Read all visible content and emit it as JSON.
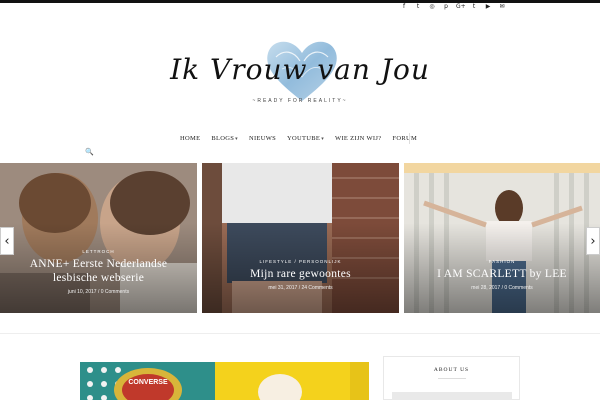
{
  "social_icons": [
    {
      "name": "facebook-icon",
      "glyph": "f"
    },
    {
      "name": "twitter-icon",
      "glyph": "t"
    },
    {
      "name": "instagram-icon",
      "glyph": "◎"
    },
    {
      "name": "pinterest-icon",
      "glyph": "p"
    },
    {
      "name": "google-plus-icon",
      "glyph": "G+"
    },
    {
      "name": "tumblr-icon",
      "glyph": "t"
    },
    {
      "name": "youtube-icon",
      "glyph": "▶"
    },
    {
      "name": "email-icon",
      "glyph": "✉"
    }
  ],
  "logo": {
    "wordmark": "Ik Vrouw van Jou",
    "tagline": "~READY FOR REALITY~"
  },
  "nav": {
    "items": [
      {
        "label": "HOME",
        "has_dropdown": false
      },
      {
        "label": "BLOGS",
        "has_dropdown": true
      },
      {
        "label": "NIEUWS",
        "has_dropdown": false
      },
      {
        "label": "YOUTUBE",
        "has_dropdown": true
      },
      {
        "label": "WIE ZIJN WIJ?",
        "has_dropdown": false
      },
      {
        "label": "FORUM",
        "has_dropdown": false
      }
    ],
    "search_icon": "🔍"
  },
  "slides": [
    {
      "category": "LETTROCH",
      "title_line1": "ANNE+ Eerste Nederlandse",
      "title_line2": "lesbische webserie",
      "date": "juni 10, 2017",
      "comments": "0 Comments"
    },
    {
      "category": "LIFESTYLE / PERSOONLIJK",
      "title_line1": "Mijn rare gewoontes",
      "title_line2": "",
      "date": "mei 31, 2017",
      "comments": "24 Comments"
    },
    {
      "category": "FASHION",
      "title_line1": "I AM SCARLETT by LEE",
      "title_line2": "",
      "date": "mei 28, 2017",
      "comments": "0 Comments"
    }
  ],
  "slider_nav": {
    "prev": "‹",
    "next": "›"
  },
  "sidebar": {
    "about_title": "ABOUT US"
  }
}
